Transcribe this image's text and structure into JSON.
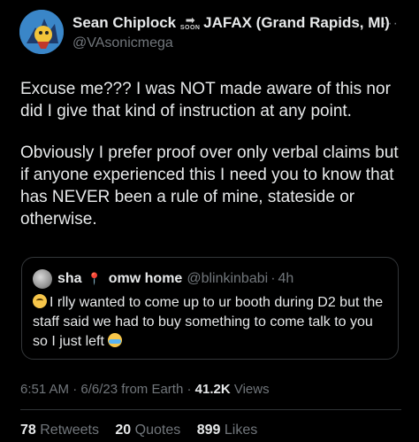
{
  "author": {
    "display_name": "Sean Chiplock",
    "soon_label": "SOON",
    "display_name_suffix": "JAFAX (Grand Rapids, MI)",
    "handle": "@VAsonicmega"
  },
  "more_icon": "more-horizontal-icon",
  "tweet": {
    "paragraphs": [
      "Excuse me??? I was NOT made aware of this nor did I give that kind of instruction at any point.",
      "Obviously I prefer proof over only verbal claims but if anyone experienced this I need you to know that has NEVER been a rule of mine, stateside or otherwise."
    ]
  },
  "quote": {
    "name": "sha",
    "name_suffix": "omw home",
    "handle": "@blinkinbabi",
    "dot": "·",
    "time": "4h",
    "text": "I rlly wanted to come up to ur booth during D2 but the staff said we had to buy something to come talk to you so I just left"
  },
  "meta": {
    "time": "6:51 AM",
    "date": "6/6/23",
    "source": "from Earth",
    "views_count": "41.2K",
    "views_label": "Views",
    "separator": "·"
  },
  "stats": {
    "retweets_count": "78",
    "retweets_label": "Retweets",
    "quotes_count": "20",
    "quotes_label": "Quotes",
    "likes_count": "899",
    "likes_label": "Likes"
  },
  "colors": {
    "background": "#000000",
    "text_primary": "#e7e9ea",
    "text_secondary": "#71767b",
    "border": "#333639"
  }
}
